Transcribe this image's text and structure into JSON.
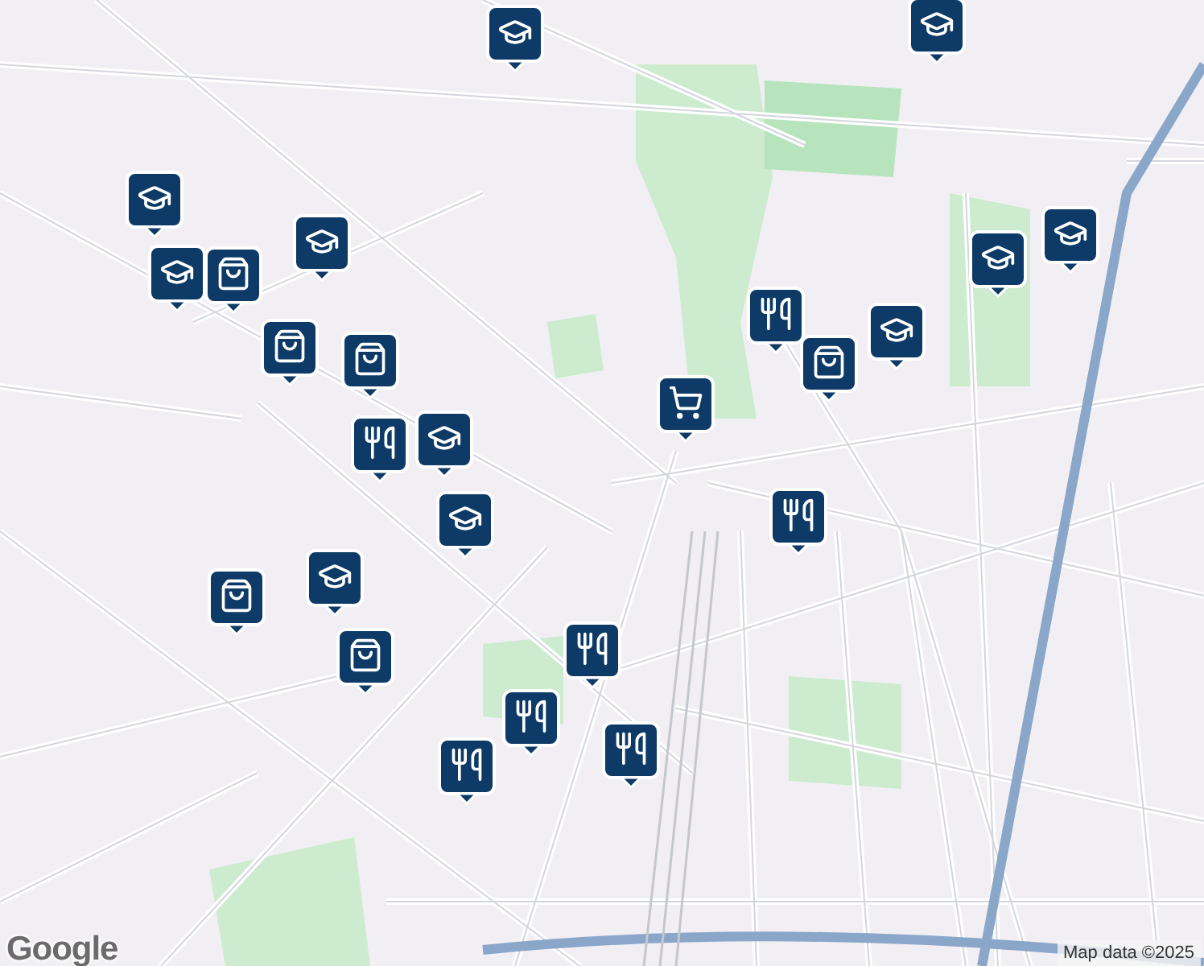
{
  "markers": [
    {
      "kind": "school"
    },
    {
      "kind": "school"
    },
    {
      "kind": "school"
    },
    {
      "kind": "school"
    },
    {
      "kind": "school"
    },
    {
      "kind": "school"
    },
    {
      "kind": "school"
    },
    {
      "kind": "school"
    },
    {
      "kind": "school"
    },
    {
      "kind": "school"
    },
    {
      "kind": "school"
    },
    {
      "kind": "restaurant"
    },
    {
      "kind": "restaurant"
    },
    {
      "kind": "restaurant"
    },
    {
      "kind": "restaurant"
    },
    {
      "kind": "restaurant"
    },
    {
      "kind": "restaurant"
    },
    {
      "kind": "restaurant"
    },
    {
      "kind": "shopping"
    },
    {
      "kind": "shopping"
    },
    {
      "kind": "shopping"
    },
    {
      "kind": "shopping"
    },
    {
      "kind": "shopping"
    },
    {
      "kind": "shopping"
    },
    {
      "kind": "grocery"
    }
  ],
  "logo": "Google",
  "attribution": "Map data ©2025"
}
